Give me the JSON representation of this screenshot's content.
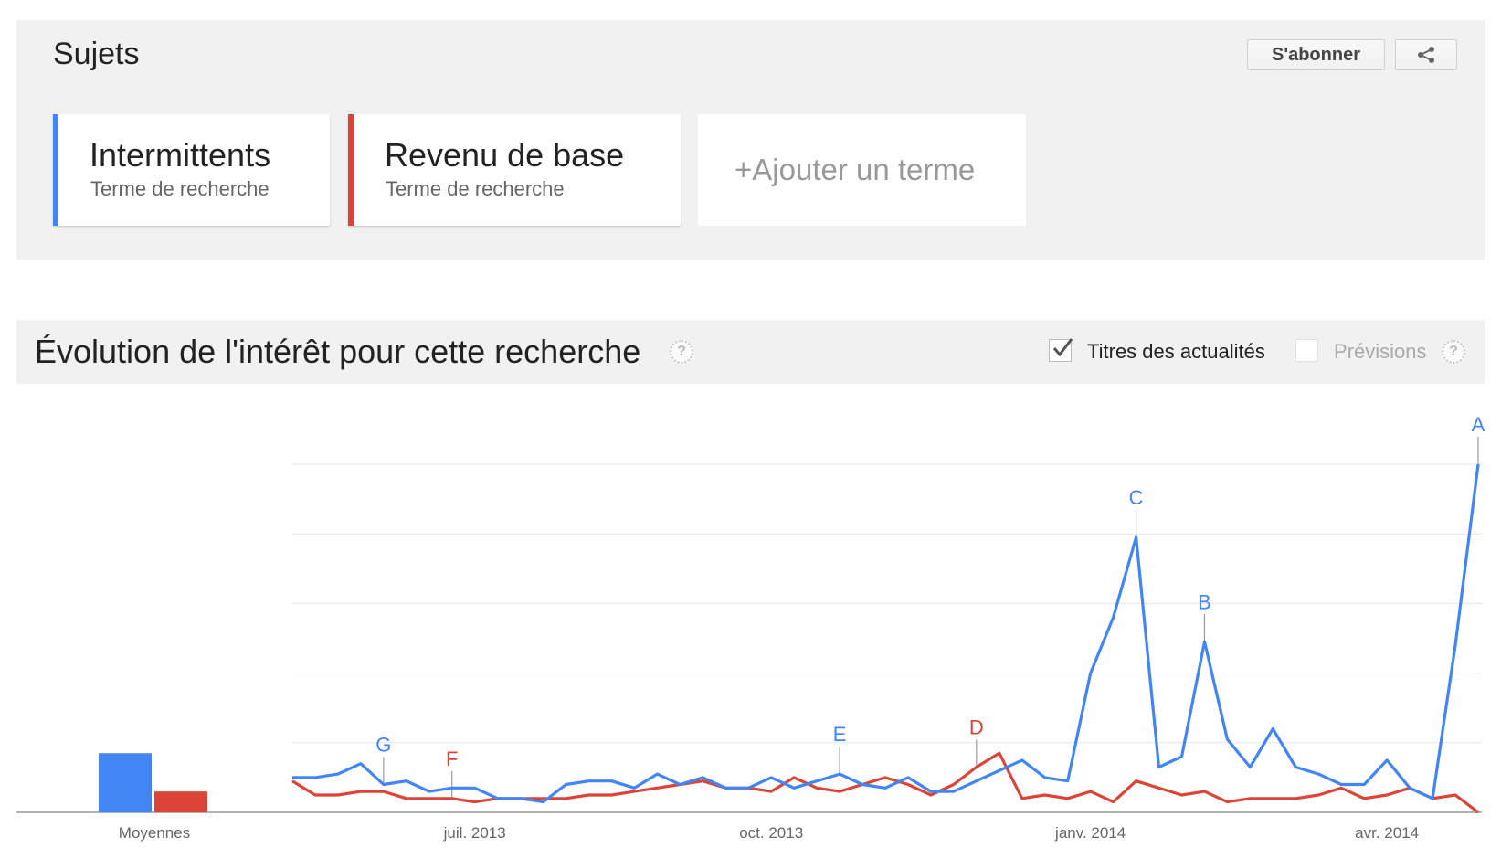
{
  "topics": {
    "title": "Sujets",
    "subscribe_label": "S'abonner",
    "share_icon": "share-icon",
    "terms": [
      {
        "name": "Intermittents",
        "type": "Terme de recherche",
        "color": "#4285f4"
      },
      {
        "name": "Revenu de base",
        "type": "Terme de recherche",
        "color": "#db4437"
      }
    ],
    "add_term_label": "+Ajouter un terme"
  },
  "interest": {
    "title": "Évolution de l'intérêt pour cette recherche",
    "help_icon": "help-icon",
    "news_headlines_label": "Titres des actualités",
    "news_headlines_checked": true,
    "forecast_label": "Prévisions",
    "forecast_checked": false
  },
  "chart_data": {
    "type": "line",
    "x_start": "2013-05-05",
    "x_step_days": 7,
    "x_ticks": [
      {
        "label": "juil. 2013",
        "date": "2013-06-30"
      },
      {
        "label": "oct. 2013",
        "date": "2013-09-29"
      },
      {
        "label": "janv. 2014",
        "date": "2014-01-05"
      },
      {
        "label": "avr. 2014",
        "date": "2014-04-06"
      }
    ],
    "ylim": [
      0,
      100
    ],
    "grid": true,
    "series": [
      {
        "name": "Intermittents",
        "color": "#4285f4",
        "values": [
          10,
          10,
          11,
          14,
          8,
          9,
          6,
          7,
          7,
          4,
          4,
          3,
          8,
          9,
          9,
          7,
          11,
          8,
          10,
          7,
          7,
          10,
          7,
          9,
          11,
          8,
          7,
          10,
          6,
          6,
          9,
          12,
          15,
          10,
          9,
          40,
          56,
          79,
          13,
          16,
          49,
          21,
          13,
          24,
          13,
          11,
          8,
          8,
          15,
          7,
          4,
          48,
          100
        ]
      },
      {
        "name": "Revenu de base",
        "color": "#db4437",
        "values": [
          9,
          5,
          5,
          6,
          6,
          4,
          4,
          4,
          3,
          4,
          4,
          4,
          4,
          5,
          5,
          6,
          7,
          8,
          9,
          7,
          7,
          6,
          10,
          7,
          6,
          8,
          10,
          8,
          5,
          8,
          13,
          17,
          4,
          5,
          4,
          6,
          3,
          9,
          7,
          5,
          6,
          3,
          4,
          4,
          4,
          5,
          7,
          4,
          5,
          7,
          4,
          5,
          0
        ]
      }
    ],
    "averages": [
      {
        "name": "Intermittents",
        "value": 17
      },
      {
        "name": "Revenu de base",
        "value": 6
      }
    ],
    "averages_label": "Moyennes",
    "annotations": [
      {
        "letter": "G",
        "series": 0,
        "index": 4
      },
      {
        "letter": "F",
        "series": 1,
        "index": 7
      },
      {
        "letter": "E",
        "series": 0,
        "index": 24
      },
      {
        "letter": "D",
        "series": 1,
        "index": 30
      },
      {
        "letter": "C",
        "series": 0,
        "index": 37
      },
      {
        "letter": "B",
        "series": 0,
        "index": 40
      },
      {
        "letter": "A",
        "series": 0,
        "index": 52
      }
    ]
  }
}
